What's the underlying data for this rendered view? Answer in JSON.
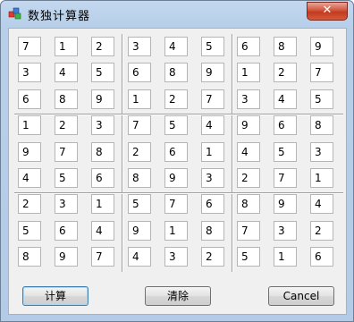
{
  "window": {
    "title": "数独计算器",
    "close_label": "✕"
  },
  "grid": [
    [
      "7",
      "1",
      "2",
      "3",
      "4",
      "5",
      "6",
      "8",
      "9"
    ],
    [
      "3",
      "4",
      "5",
      "6",
      "8",
      "9",
      "1",
      "2",
      "7"
    ],
    [
      "6",
      "8",
      "9",
      "1",
      "2",
      "7",
      "3",
      "4",
      "5"
    ],
    [
      "1",
      "2",
      "3",
      "7",
      "5",
      "4",
      "9",
      "6",
      "8"
    ],
    [
      "9",
      "7",
      "8",
      "2",
      "6",
      "1",
      "4",
      "5",
      "3"
    ],
    [
      "4",
      "5",
      "6",
      "8",
      "9",
      "3",
      "2",
      "7",
      "1"
    ],
    [
      "2",
      "3",
      "1",
      "5",
      "7",
      "6",
      "8",
      "9",
      "4"
    ],
    [
      "5",
      "6",
      "4",
      "9",
      "1",
      "8",
      "7",
      "3",
      "2"
    ],
    [
      "8",
      "9",
      "7",
      "4",
      "3",
      "2",
      "5",
      "1",
      "6"
    ]
  ],
  "buttons": {
    "calc": "计算",
    "clear": "清除",
    "cancel": "Cancel"
  }
}
